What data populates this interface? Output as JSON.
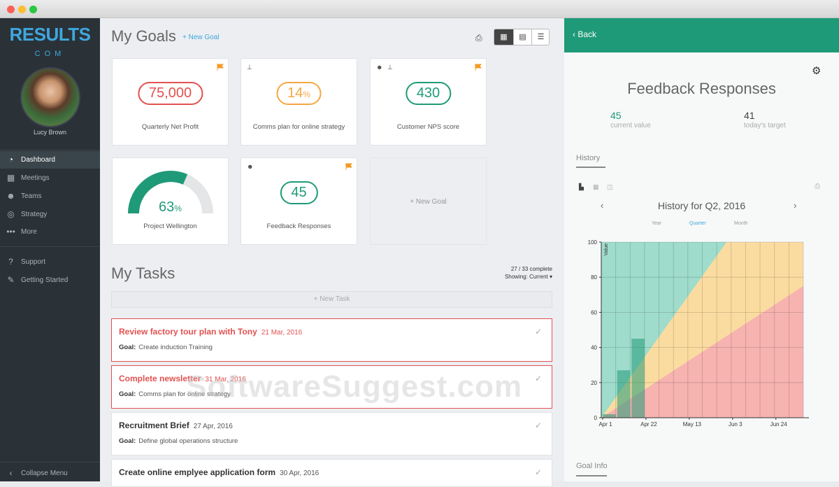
{
  "window": {
    "controls": [
      "close",
      "minimize",
      "maximize"
    ]
  },
  "sidebar": {
    "logo_main": "RESULTS",
    "logo_sub": "COM",
    "user_name": "Lucy Brown",
    "items": [
      {
        "label": "Dashboard",
        "icon": "dashboard-icon"
      },
      {
        "label": "Meetings",
        "icon": "calendar-icon"
      },
      {
        "label": "Teams",
        "icon": "people-icon"
      },
      {
        "label": "Strategy",
        "icon": "compass-icon"
      },
      {
        "label": "More",
        "icon": "more-icon"
      }
    ],
    "bottom_items": [
      {
        "label": "Support",
        "icon": "help-icon"
      },
      {
        "label": "Getting Started",
        "icon": "wrench-icon"
      }
    ],
    "collapse_label": "Collapse Menu"
  },
  "goals": {
    "title": "My Goals",
    "new_goal_link": "+ New Goal",
    "cards": [
      {
        "value": "75,000",
        "label": "Quarterly Net Profit",
        "color": "#e2514f"
      },
      {
        "value": "14",
        "suffix": "%",
        "label": "Comms plan for online strategy",
        "color": "#f5a742"
      },
      {
        "value": "430",
        "label": "Customer NPS score",
        "color": "#1f9a78"
      },
      {
        "value": "63",
        "suffix": "%",
        "label": "Project Wellington",
        "color": "#1f9a78",
        "progress": 0.63
      },
      {
        "value": "45",
        "label": "Feedback Responses",
        "color": "#1f9a78"
      }
    ],
    "new_goal_card": "+ New Goal"
  },
  "tasks": {
    "title": "My Tasks",
    "summary": "27 / 33 complete",
    "showing": "Showing: Current",
    "new_task": "+ New Task",
    "goal_prefix": "Goal:",
    "items": [
      {
        "title": "Review factory tour plan with Tony",
        "date": "21 Mar, 2016",
        "goal": "Create induction Training",
        "overdue": true
      },
      {
        "title": "Complete newsletter",
        "date": "31 Mar, 2016",
        "goal": "Comms plan for online strategy",
        "overdue": true
      },
      {
        "title": "Recruitment Brief",
        "date": "27 Apr, 2016",
        "goal": "Define global operations structure",
        "overdue": false
      },
      {
        "title": "Create online emplyee application form",
        "date": "30 Apr, 2016",
        "goal": "",
        "overdue": false
      }
    ]
  },
  "panel": {
    "back_label": "Back",
    "title": "Feedback Responses",
    "current_value": "45",
    "current_label": "current value",
    "target_value": "41",
    "target_label": "today's target",
    "history_tab": "History",
    "chart_title": "History for Q2, 2016",
    "periods": [
      "Year",
      "Quarter",
      "Month"
    ],
    "selected_period": "Quarter",
    "goal_info_tab": "Goal Info"
  },
  "chart_data": {
    "type": "bar",
    "title": "History for Q2, 2016",
    "ylabel": "Value",
    "ylim": [
      0,
      100
    ],
    "y_ticks": [
      0,
      20,
      40,
      60,
      80,
      100
    ],
    "x_ticks": [
      "Apr 1",
      "Apr 22",
      "May 13",
      "Jun 3",
      "Jun 24"
    ],
    "bars": [
      {
        "x": "Apr 1",
        "value": 2
      },
      {
        "x": "Apr 8",
        "value": 27
      },
      {
        "x": "Apr 15",
        "value": 45
      }
    ],
    "bands": [
      {
        "name": "green",
        "color": "#9fdccb"
      },
      {
        "name": "amber",
        "color": "#fbdca0"
      },
      {
        "name": "red",
        "color": "#f6b3b0"
      }
    ],
    "grid": true
  },
  "watermark": "SoftwareSuggest.com"
}
